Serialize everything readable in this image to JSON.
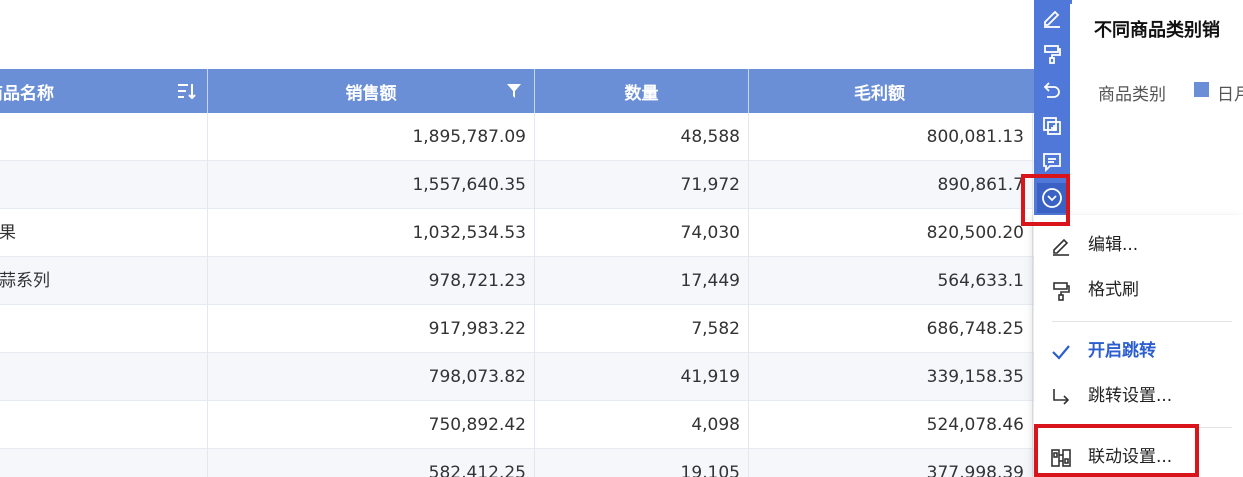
{
  "table": {
    "headers": [
      "商品名称",
      "销售额",
      "数量",
      "毛利额"
    ],
    "rows": [
      {
        "name": "",
        "sales": "1,895,787.09",
        "qty": "48,588",
        "profit": "800,081.13"
      },
      {
        "name": "",
        "sales": "1,557,640.35",
        "qty": "71,972",
        "profit": "890,861.7"
      },
      {
        "name": "果",
        "sales": "1,032,534.53",
        "qty": "74,030",
        "profit": "820,500.20"
      },
      {
        "name": "蒜系列",
        "sales": "978,721.23",
        "qty": "17,449",
        "profit": "564,633.1"
      },
      {
        "name": "",
        "sales": "917,983.22",
        "qty": "7,582",
        "profit": "686,748.25"
      },
      {
        "name": "",
        "sales": "798,073.82",
        "qty": "41,919",
        "profit": "339,158.35"
      },
      {
        "name": "",
        "sales": "750,892.42",
        "qty": "4,098",
        "profit": "524,078.46"
      },
      {
        "name": "",
        "sales": "582,412.25",
        "qty": "19,105",
        "profit": "377,998.39"
      }
    ]
  },
  "side_panel": {
    "title": "不同商品类别销",
    "legend_label": "商品类别",
    "legend_item": "日月"
  },
  "toolbar_icons": [
    "edit-icon",
    "format-brush-icon",
    "undo-icon",
    "copy-icon",
    "comment-icon",
    "more-chevron-icon"
  ],
  "menu": {
    "edit": "编辑...",
    "format_brush": "格式刷",
    "enable_jump": "开启跳转",
    "jump_settings": "跳转设置...",
    "linkage_settings": "联动设置..."
  },
  "colors": {
    "header_bg": "#6a8fd6",
    "toolbar_bg": "#5078d8",
    "highlight_red": "#d9151b",
    "accent_blue": "#2c5ed0"
  }
}
